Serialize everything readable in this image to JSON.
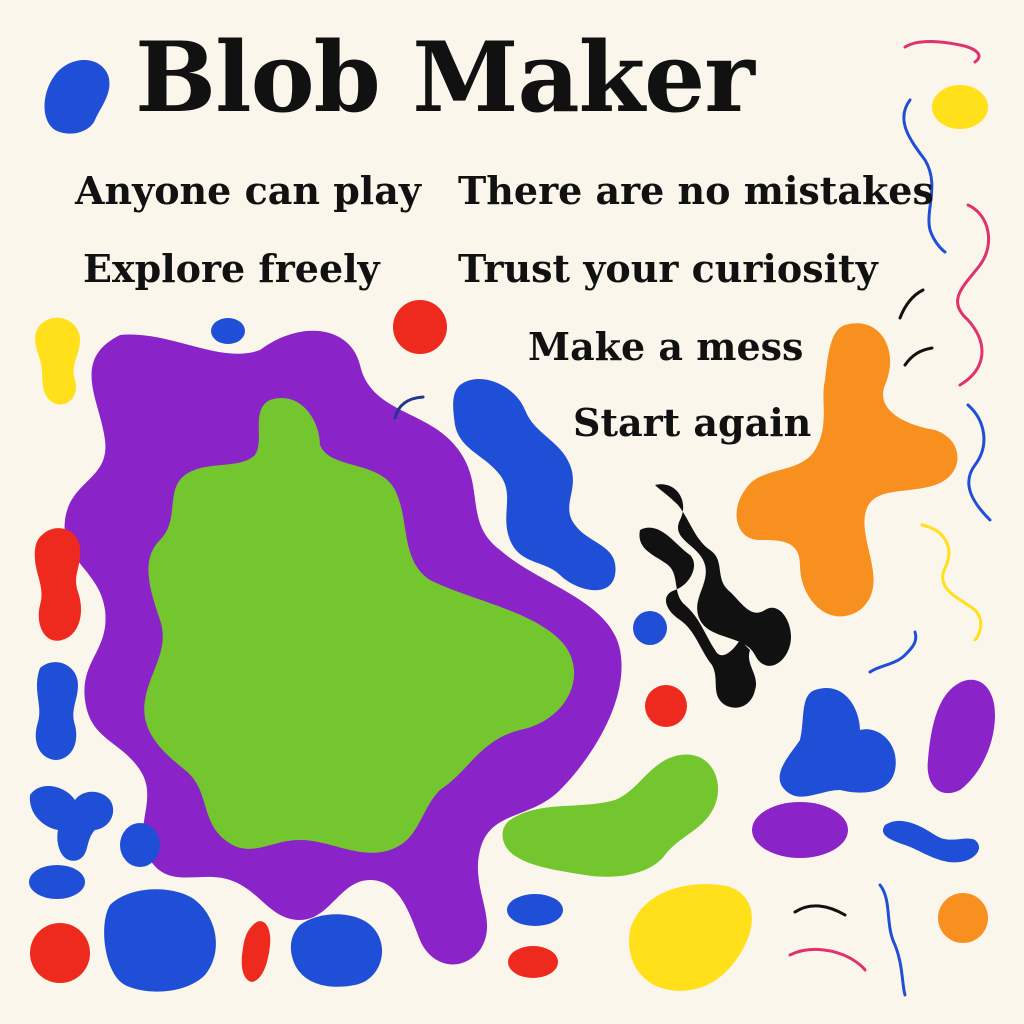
{
  "title": "Blob Maker",
  "phrases": [
    "Anyone can play",
    "There are no mistakes",
    "Explore freely",
    "Trust your curiosity",
    "Make a mess",
    "Start again"
  ],
  "colors": {
    "background": "#fbf6ec",
    "blue": "#1f4fd6",
    "red": "#ee2a1e",
    "yellow": "#ffe01a",
    "purple": "#8a23c8",
    "green": "#74c62f",
    "orange": "#f7901e",
    "black": "#111111",
    "pink": "#e0326e"
  }
}
